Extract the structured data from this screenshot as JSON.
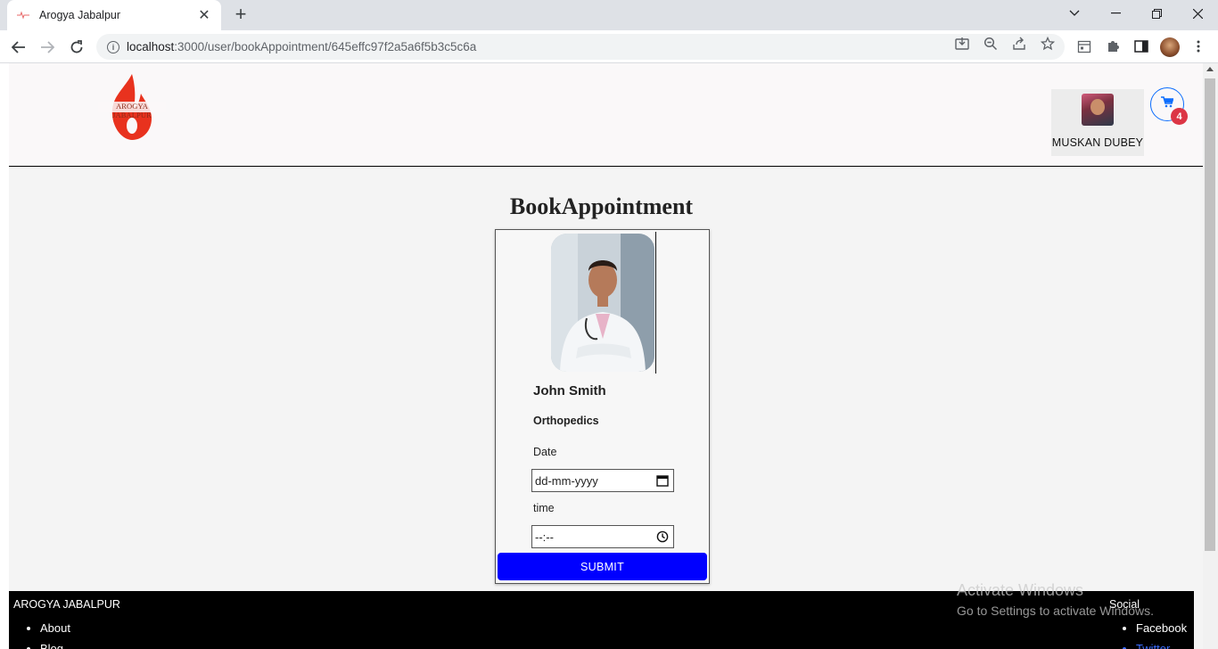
{
  "browser": {
    "tab_title": "Arogya Jabalpur",
    "tab_close": "✕",
    "new_tab": "+",
    "url_host": "localhost",
    "url_path": ":3000/user/bookAppointment/645effc97f2a5a6f5b3c5c6a"
  },
  "header": {
    "logo_text": "AROGYA JABALPUR",
    "user_name": "MUSKAN DUBEY",
    "cart_count": "4"
  },
  "main": {
    "heading": "BookAppointment",
    "doctor_name": "John Smith",
    "doctor_specialty": "Orthopedics",
    "date_label": "Date",
    "date_placeholder": "dd-mm-yyyy",
    "time_label": "time",
    "time_placeholder": "--:--",
    "submit_label": "SUBMIT"
  },
  "footer": {
    "brand": "AROGYA JABALPUR",
    "links": [
      "About",
      "Blog"
    ],
    "social_title": "Social",
    "social_links": [
      "Facebook",
      "Twitter"
    ]
  },
  "overlay": {
    "activate_title": "Activate Windows",
    "activate_subtitle": "Go to Settings to activate Windows."
  },
  "colors": {
    "submit_bg": "#0000ff",
    "cart_accent": "#0d6efd",
    "badge": "#dc3545",
    "logo": "#e8321e"
  }
}
